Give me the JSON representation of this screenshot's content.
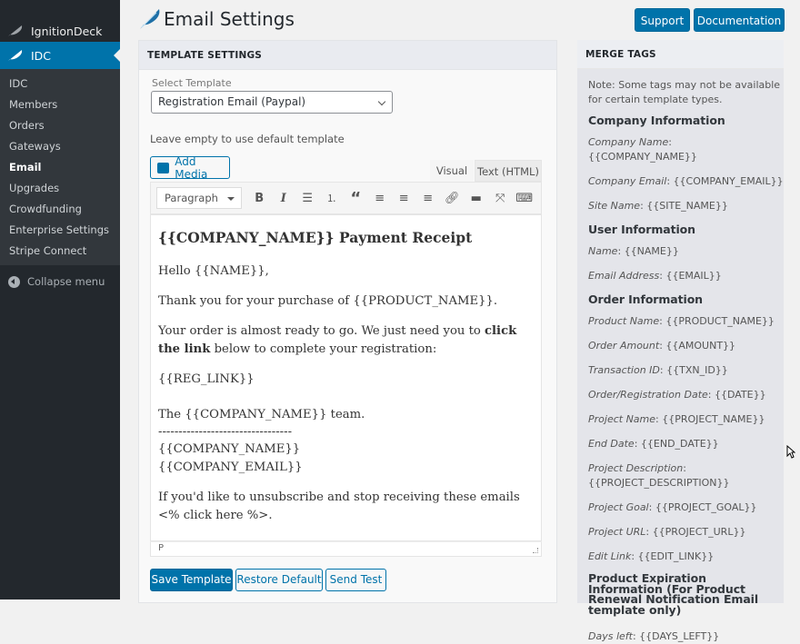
{
  "sidebar": {
    "brand": "IgnitionDeck",
    "active": "IDC",
    "items": [
      "IDC",
      "Members",
      "Orders",
      "Gateways",
      "Email",
      "Upgrades",
      "Crowdfunding",
      "Enterprise Settings",
      "Stripe Connect"
    ],
    "current": "Email",
    "collapse": "Collapse menu"
  },
  "header": {
    "title": "Email Settings",
    "support": "Support",
    "documentation": "Documentation"
  },
  "template": {
    "heading": "TEMPLATE SETTINGS",
    "select_label": "Select Template",
    "select_value": "Registration Email (Paypal)",
    "hint": "Leave empty to use default template",
    "add_media": "Add Media",
    "tab_visual": "Visual",
    "tab_text": "Text (HTML)",
    "format": "Paragraph",
    "editor": {
      "heading": "{{COMPANY_NAME}} Payment Receipt",
      "p1": "Hello {{NAME}},",
      "p2": "Thank you for your purchase of {{PRODUCT_NAME}}.",
      "p3a": "Your order is almost ready to go. We just need you to ",
      "p3b": "click the link",
      "p3c": " below to complete your registration:",
      "p4": "{{REG_LINK}}",
      "p5": "The {{COMPANY_NAME}} team.",
      "p6": "---------------------------------",
      "p7": "{{COMPANY_NAME}}",
      "p8": "{{COMPANY_EMAIL}}",
      "p9": "If you'd like to unsubscribe and stop receiving these emails <% click here %>."
    },
    "status_path": "P",
    "save": "Save Template",
    "restore": "Restore Default",
    "send_test": "Send Test"
  },
  "merge": {
    "heading": "MERGE TAGS",
    "note": "Note: Some tags may not be available for certain template types.",
    "company": "Company Information",
    "company_items": [
      {
        "k": "Company Name",
        "v": ": {{COMPANY_NAME}}"
      },
      {
        "k": "Company Email",
        "v": ": {{COMPANY_EMAIL}}"
      },
      {
        "k": "Site Name",
        "v": ": {{SITE_NAME}}"
      }
    ],
    "user": "User Information",
    "user_items": [
      {
        "k": "Name",
        "v": ": {{NAME}}"
      },
      {
        "k": "Email Address",
        "v": ": {{EMAIL}}"
      }
    ],
    "order": "Order Information",
    "order_items": [
      {
        "k": "Product Name",
        "v": ": {{PRODUCT_NAME}}"
      },
      {
        "k": "Order Amount",
        "v": ": {{AMOUNT}}"
      },
      {
        "k": "Transaction ID",
        "v": ": {{TXN_ID}}"
      },
      {
        "k": "Order/Registration Date",
        "v": ": {{DATE}}"
      },
      {
        "k": "Project Name",
        "v": ": {{PROJECT_NAME}}"
      },
      {
        "k": "End Date",
        "v": ": {{END_DATE}}"
      },
      {
        "k": "Project Description",
        "v": ": {{PROJECT_DESCRIPTION}}"
      },
      {
        "k": "Project Goal",
        "v": ": {{PROJECT_GOAL}}"
      },
      {
        "k": "Project URL",
        "v": ": {{PROJECT_URL}}"
      },
      {
        "k": "Edit Link",
        "v": ": {{EDIT_LINK}}"
      }
    ],
    "expiration": "Product Expiration Information (For Product Renewal Notification Email template only)",
    "expiration_items": [
      {
        "k": "Days left",
        "v": ": {{DAYS_LEFT}}"
      }
    ]
  }
}
